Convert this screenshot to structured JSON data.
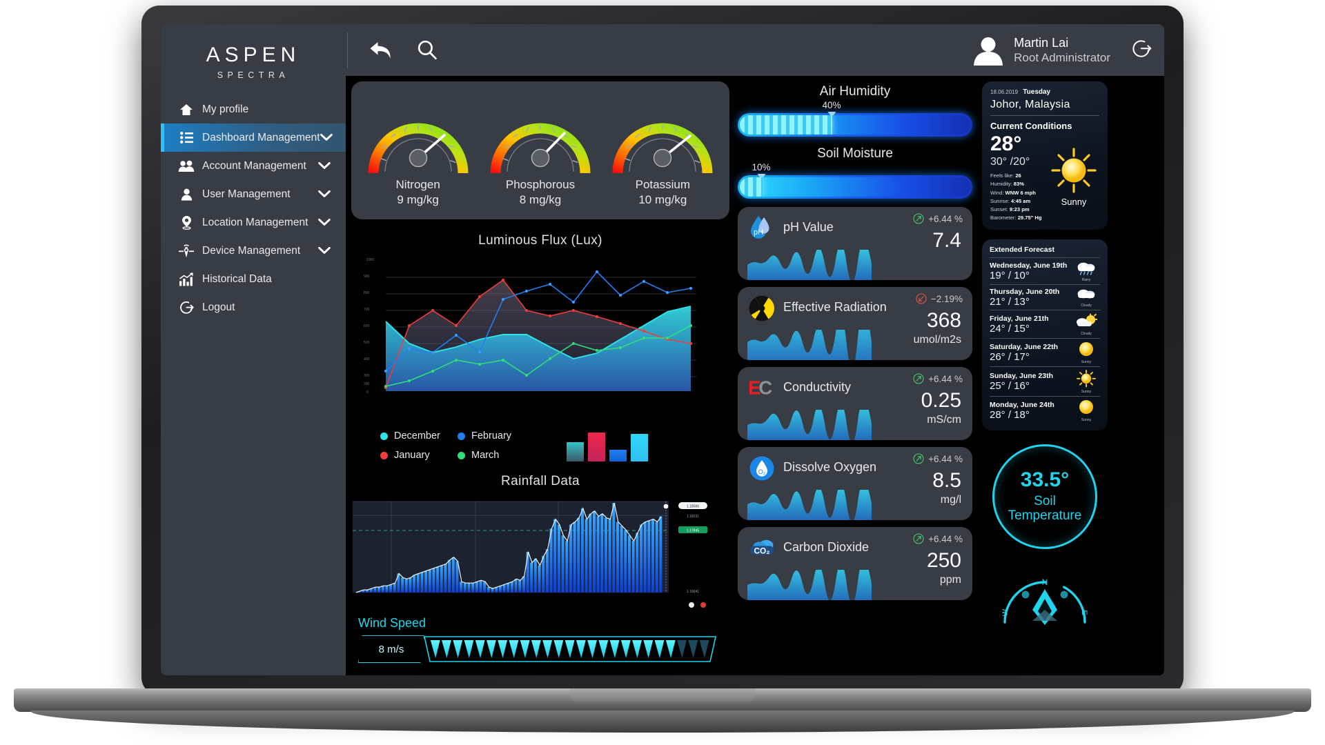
{
  "brand": {
    "name": "ASPEN",
    "tagline": "SPECTRA"
  },
  "sidebar": {
    "items": [
      {
        "label": "My profile",
        "icon": "home-icon",
        "chevron": false,
        "active": false
      },
      {
        "label": "Dashboard Management",
        "icon": "list-icon",
        "chevron": true,
        "active": true
      },
      {
        "label": "Account Management",
        "icon": "users-icon",
        "chevron": true,
        "active": false
      },
      {
        "label": "User Management",
        "icon": "user-icon",
        "chevron": true,
        "active": false
      },
      {
        "label": "Location Management",
        "icon": "pin-icon",
        "chevron": true,
        "active": false
      },
      {
        "label": "Device Management",
        "icon": "sensor-icon",
        "chevron": true,
        "active": false
      },
      {
        "label": "Historical Data",
        "icon": "bar-chart-icon",
        "chevron": false,
        "active": false
      },
      {
        "label": "Logout",
        "icon": "logout-icon",
        "chevron": false,
        "active": false
      }
    ]
  },
  "topbar": {
    "back_icon": "back-arrow-icon",
    "search_icon": "search-icon",
    "logout_icon": "logout-icon",
    "user": {
      "name": "Martin Lai",
      "role": "Root Administrator"
    }
  },
  "npk": {
    "gauges": [
      {
        "name": "Nitrogen",
        "value": "9 mg/kg",
        "percent": 62
      },
      {
        "name": "Phosphorous",
        "value": "8 mg/kg",
        "percent": 60
      },
      {
        "name": "Potassium",
        "value": "10 mg/kg",
        "percent": 64
      }
    ]
  },
  "meters": [
    {
      "label": "Air Humidity",
      "percent_label": "40%",
      "percent": 40
    },
    {
      "label": "Soil Moisture",
      "percent_label": "10%",
      "percent": 10
    }
  ],
  "sensors": [
    {
      "name": "pH Value",
      "icon": "ph-drop-icon",
      "value": "7.4",
      "unit": "",
      "delta": "+6.44 %",
      "direction": "up",
      "delta_color": "#49c96a"
    },
    {
      "name": "Effective Radiation",
      "icon": "radiation-icon",
      "value": "368",
      "unit": "umol/m2s",
      "delta": "−2.19%",
      "direction": "down",
      "delta_color": "#e4563f"
    },
    {
      "name": "Conductivity",
      "icon": "ec-icon",
      "value": "0.25",
      "unit": "mS/cm",
      "delta": "+6.44 %",
      "direction": "up",
      "delta_color": "#49c96a"
    },
    {
      "name": "Dissolve Oxygen",
      "icon": "o2-drop-icon",
      "value": "8.5",
      "unit": "mg/l",
      "delta": "+6.44 %",
      "direction": "up",
      "delta_color": "#49c96a"
    },
    {
      "name": "Carbon Dioxide",
      "icon": "co2-cloud-icon",
      "value": "250",
      "unit": "ppm",
      "delta": "+6.44 %",
      "direction": "up",
      "delta_color": "#49c96a"
    }
  ],
  "weather": {
    "date": "18.06.2019",
    "weekday": "Tuesday",
    "city": "Johor, Malaysia",
    "conditions_title": "Current Conditions",
    "temp": "28°",
    "hi_lo": "30° /20°",
    "feels_like_label": "Feels like:",
    "feels_like": "26",
    "humidity_label": "Humidity:",
    "humidity": "83%",
    "wind_label": "Wind:",
    "wind": "WNW 6 mph",
    "sunrise_label": "Sunrise:",
    "sunrise": "4:45 am",
    "sunset_label": "Sunset:",
    "sunset": "9:23 pm",
    "barometer_label": "Barometer:",
    "barometer": "29.75\" Hg",
    "summary": "Sunny",
    "icon": "sun-icon"
  },
  "forecast": {
    "title": "Extended Forecast",
    "days": [
      {
        "day": "Wednesday, June 19th",
        "temps": "19° / 10°",
        "icon": "rain-icon",
        "caption": "Rainy"
      },
      {
        "day": "Thursday, June 20th",
        "temps": "21° / 13°",
        "icon": "cloud-icon",
        "caption": "Cloudy"
      },
      {
        "day": "Friday, June 21th",
        "temps": "24° / 15°",
        "icon": "partly-icon",
        "caption": "Cloudy"
      },
      {
        "day": "Saturday, June 22th",
        "temps": "26° / 17°",
        "icon": "sun-icon",
        "caption": "Sunny"
      },
      {
        "day": "Sunday, June 23th",
        "temps": "25° / 16°",
        "icon": "sun-ray-icon",
        "caption": "Sunny"
      },
      {
        "day": "Monday, June 24th",
        "temps": "28° / 18°",
        "icon": "sun-icon",
        "caption": "Sunny"
      }
    ]
  },
  "soil_temperature": {
    "value": "33.5°",
    "label_line1": "Soil",
    "label_line2": "Temperature"
  },
  "compass": {
    "north": "N",
    "west": "W",
    "east": "E"
  },
  "wind_speed": {
    "title": "Wind Speed",
    "value": "8 m/s",
    "segments_total": 25,
    "segments_filled": 22
  },
  "rainfall": {
    "title": "Rainfall Data",
    "label_top": "1.18560",
    "label_mid": "1.18231",
    "label_green": "1.17845",
    "label_bottom": "1.16641"
  },
  "chart_data": [
    {
      "type": "line",
      "title": "Luminous Flux (Lux)",
      "xlabel": "",
      "ylabel": "",
      "grid": true,
      "legend_position": "below",
      "ylim": [
        0,
        1000
      ],
      "x": [
        1,
        2,
        3,
        4,
        5,
        6,
        7,
        8,
        9,
        10,
        11,
        12,
        13,
        14
      ],
      "series": [
        {
          "name": "December",
          "color": "#2fe3e8",
          "values": [
            640,
            500,
            440,
            470,
            520,
            555,
            555,
            470,
            400,
            430,
            520,
            600,
            690,
            740
          ]
        },
        {
          "name": "January",
          "color": "#f23b3b",
          "values": [
            60,
            500,
            600,
            500,
            700,
            820,
            600,
            570,
            600,
            560,
            520,
            480,
            440,
            420
          ]
        },
        {
          "name": "February",
          "color": "#1f7ff2",
          "values": [
            210,
            440,
            420,
            520,
            440,
            700,
            760,
            800,
            690,
            870,
            720,
            790,
            690,
            760
          ]
        },
        {
          "name": "March",
          "color": "#2fe07a",
          "values": [
            30,
            110,
            200,
            330,
            290,
            330,
            180,
            380,
            520,
            460,
            490,
            620,
            620,
            620
          ]
        }
      ]
    },
    {
      "type": "bar",
      "title": "",
      "categories": [
        "December",
        "January",
        "February",
        "March"
      ],
      "values": [
        62,
        90,
        36,
        84
      ],
      "colors": [
        "#36c3c8",
        "#f0274b",
        "#1f7ff2",
        "#2fd9f7"
      ]
    },
    {
      "type": "area",
      "title": "Rainfall Data",
      "xlabel": "",
      "ylabel": "",
      "values": [
        8,
        9,
        10,
        10,
        11,
        12,
        12,
        13,
        13,
        14,
        15,
        22,
        19,
        18,
        19,
        21,
        22,
        23,
        24,
        25,
        26,
        27,
        28,
        29,
        32,
        34,
        31,
        16,
        15,
        15,
        15,
        16,
        17,
        16,
        12,
        11,
        12,
        13,
        14,
        15,
        16,
        18,
        17,
        20,
        38,
        30,
        33,
        28,
        35,
        40,
        55,
        62,
        58,
        50,
        46,
        58,
        60,
        63,
        70,
        62,
        66,
        68,
        64,
        66,
        63,
        62,
        74,
        60,
        57,
        54,
        50,
        46,
        52,
        58,
        60,
        61,
        62,
        60,
        64
      ]
    }
  ]
}
